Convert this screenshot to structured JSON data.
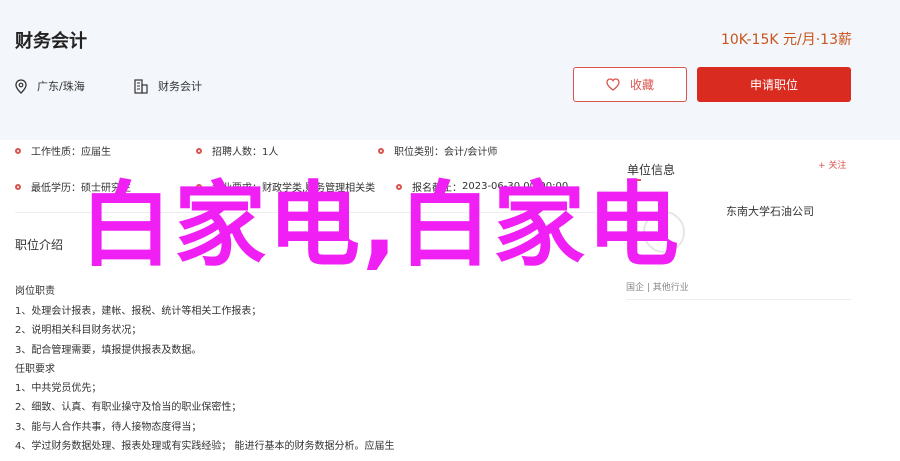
{
  "job": {
    "title": "财务会计",
    "salary": "10K-15K 元/月·13薪",
    "location": "广东/珠海",
    "category": "财务会计"
  },
  "actions": {
    "favorite_label": "收藏",
    "apply_label": "申请职位"
  },
  "info": [
    {
      "key": "工作性质：",
      "value": "应届生"
    },
    {
      "key": "招聘人数：",
      "value": "1人"
    },
    {
      "key": "职位类别：",
      "value": "会计/会计师"
    },
    {
      "key": "最低学历：",
      "value": "硕士研究生"
    },
    {
      "key": "专业要求：",
      "value": "财政学类,财务管理相关类"
    },
    {
      "key": "报名截止：",
      "value": "2023-06-30 00:00:00"
    }
  ],
  "description": {
    "title": "职位介绍",
    "lines": [
      "岗位职责",
      "1、处理会计报表，建帐、报税、统计等相关工作报表；",
      "2、说明相关科目财务状况；",
      "3、配合管理需要，填报提供报表及数据。",
      "任职要求",
      "1、中共党员优先；",
      "2、细致、认真、有职业操守及恰当的职业保密性；",
      "3、能与人合作共事，待人接物态度得当；",
      "4、学过财务数据处理、报表处理或有实践经验；     能进行基本的财务数据分析。应届生"
    ]
  },
  "company": {
    "section_title": "单位信息",
    "follow_label": "+ 关注",
    "name": "东南大学石油公司",
    "tags": "国企 | 其他行业"
  },
  "watermark": "白家电,白家电",
  "colors": {
    "accent": "#d92b1f",
    "salary": "#c8541e",
    "watermark": "#f020f5",
    "header_bg": "#f3f6fa"
  }
}
